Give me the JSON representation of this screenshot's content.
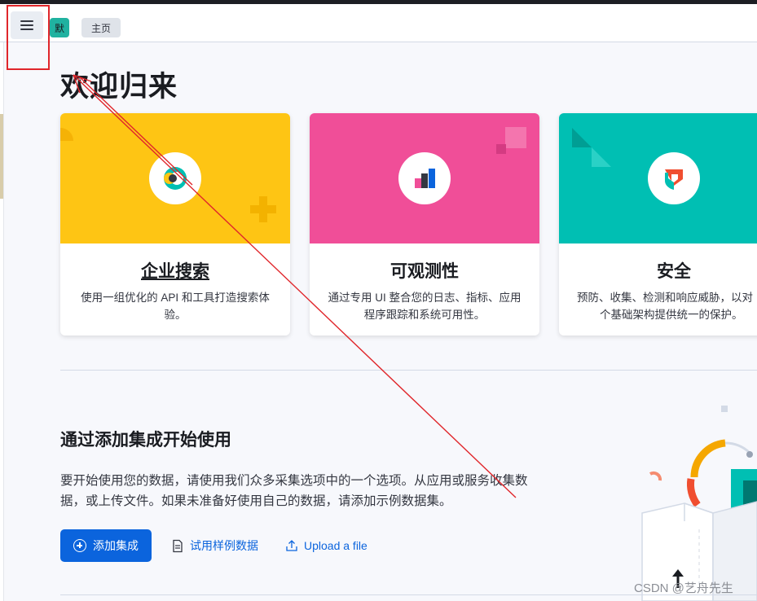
{
  "header": {
    "space_avatar_text": "默",
    "breadcrumb": "主页"
  },
  "page_title": "欢迎归来",
  "solutions": [
    {
      "title": "企业搜索",
      "description": "使用一组优化的 API 和工具打造搜索体验。",
      "banner_color": "#fec514"
    },
    {
      "title": "可观测性",
      "description": "通过专用 UI 整合您的日志、指标、应用程序跟踪和系统可用性。",
      "banner_color": "#f04e98"
    },
    {
      "title": "安全",
      "description_line1": "预防、收集、检测和响应威胁，以对",
      "description_line2": "个基础架构提供统一的保护。",
      "banner_color": "#00bfb3"
    }
  ],
  "integrations": {
    "title": "通过添加集成开始使用",
    "description": "要开始使用您的数据，请使用我们众多采集选项中的一个选项。从应用或服务收集数据，或上传文件。如果未准备好使用自己的数据，请添加示例数据集。",
    "add_button": "添加集成",
    "sample_data_link": "试用样例数据",
    "upload_link": "Upload a file"
  },
  "watermark": "CSDN @艺舟先生",
  "icons": {
    "menu": "hamburger-menu-icon",
    "search": "enterprise-search-logo-icon",
    "observability": "observability-logo-icon",
    "security": "security-logo-icon",
    "plus": "plus-circle-icon",
    "document": "document-icon",
    "upload": "upload-icon"
  },
  "colors": {
    "primary": "#0b64dd",
    "annotation": "#e0262b"
  }
}
